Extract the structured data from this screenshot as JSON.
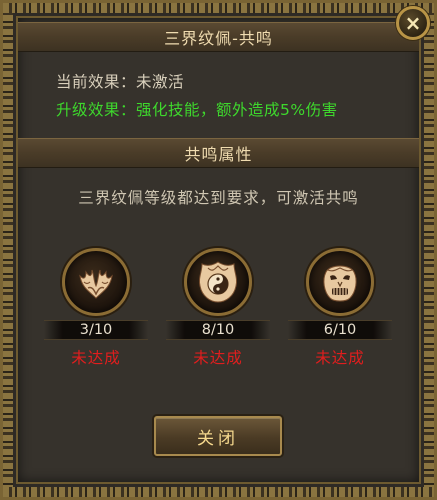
{
  "dialog": {
    "title": "三界纹佩-共鸣",
    "current_effect": "当前效果：未激活",
    "upgrade_effect": "升级效果：强化技能，额外造成5%伤害",
    "section_title": "共鸣属性",
    "description": "三界纹佩等级都达到要求，可激活共鸣",
    "close_button_label": "关闭",
    "close_icon": "×"
  },
  "items": [
    {
      "icon": "flame-wings-icon",
      "level": "3/10",
      "status": "未达成"
    },
    {
      "icon": "yin-yang-icon",
      "level": "8/10",
      "status": "未达成"
    },
    {
      "icon": "demon-mask-icon",
      "level": "6/10",
      "status": "未达成"
    }
  ],
  "colors": {
    "upgrade_text": "#3ed82d",
    "status_text": "#e01e1e",
    "title_text": "#f0dcb0",
    "button_text": "#f6d98e"
  }
}
